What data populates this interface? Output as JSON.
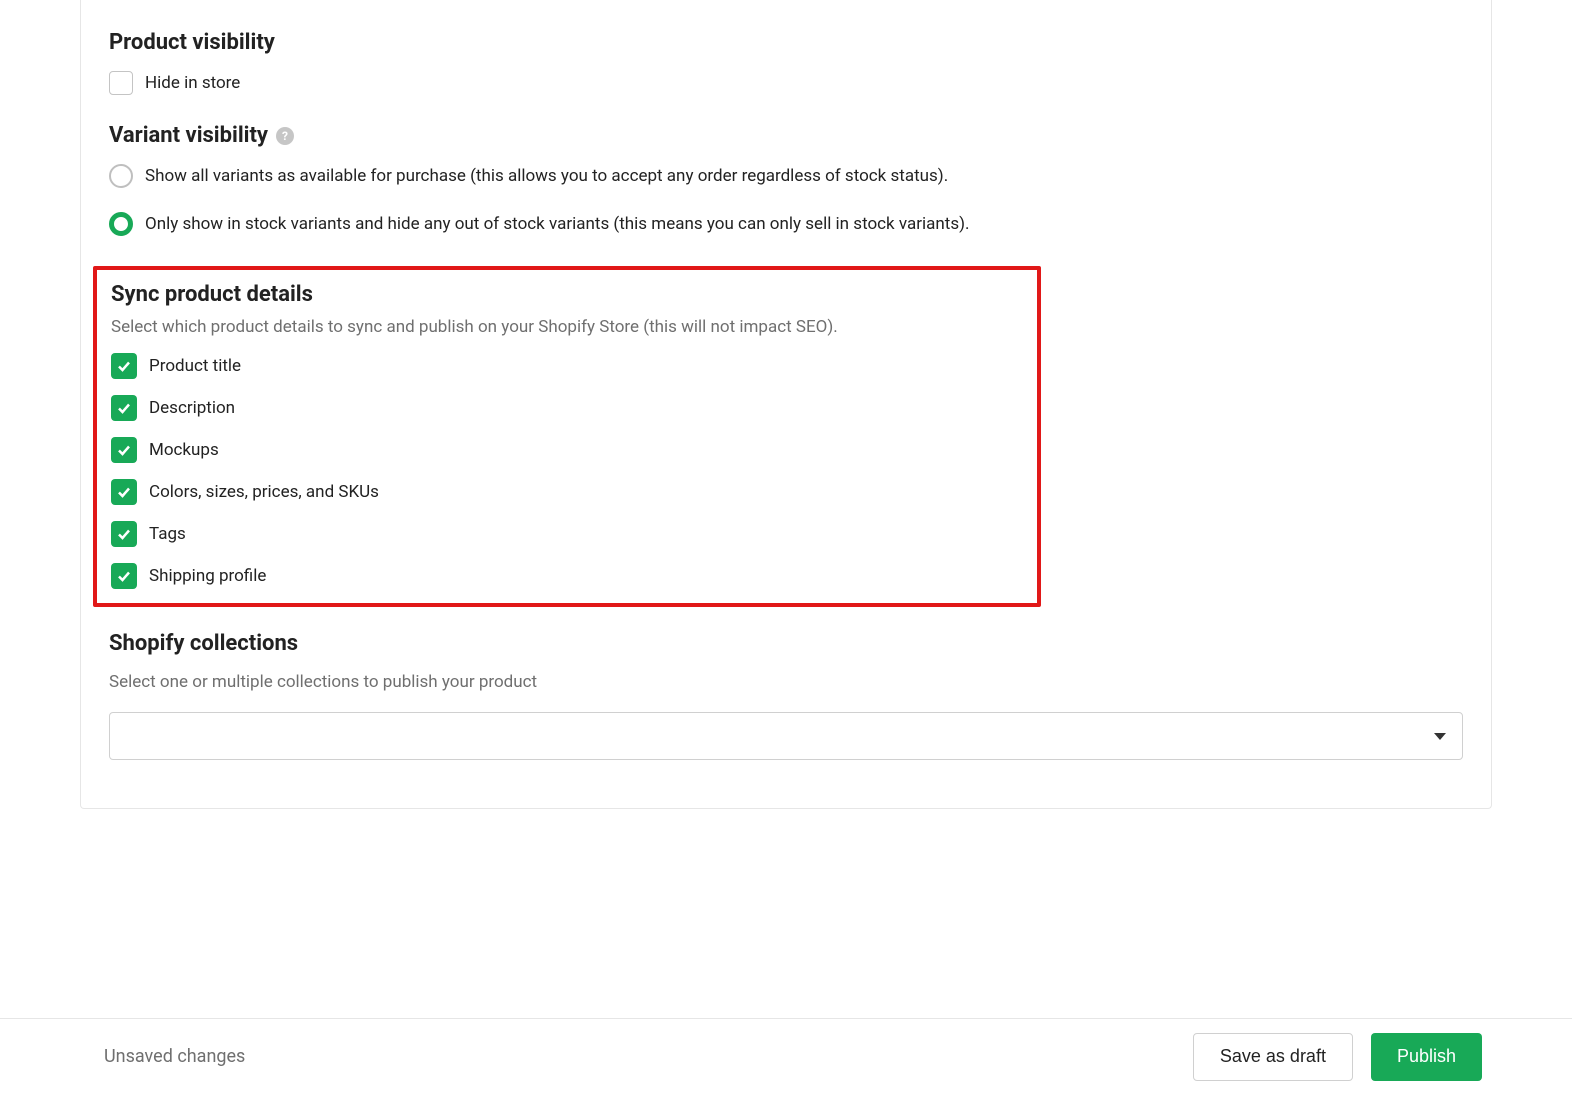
{
  "product_visibility": {
    "heading": "Product visibility",
    "hide_label": "Hide in store",
    "hide_checked": false
  },
  "variant_visibility": {
    "heading": "Variant visibility",
    "help_glyph": "?",
    "option_show_all": "Show all variants as available for purchase (this allows you to accept any order regardless of stock status).",
    "option_in_stock": "Only show in stock variants and hide any out of stock variants (this means you can only sell in stock variants).",
    "selected": "in_stock"
  },
  "sync_details": {
    "heading": "Sync product details",
    "description": "Select which product details to sync and publish on your Shopify Store (this will not impact SEO).",
    "items": [
      {
        "label": "Product title",
        "checked": true
      },
      {
        "label": "Description",
        "checked": true
      },
      {
        "label": "Mockups",
        "checked": true
      },
      {
        "label": "Colors, sizes, prices, and SKUs",
        "checked": true
      },
      {
        "label": "Tags",
        "checked": true
      },
      {
        "label": "Shipping profile",
        "checked": true
      }
    ]
  },
  "collections": {
    "heading": "Shopify collections",
    "description": "Select one or multiple collections to publish your product",
    "selected": ""
  },
  "footer": {
    "status": "Unsaved changes",
    "save_draft_label": "Save as draft",
    "publish_label": "Publish"
  }
}
